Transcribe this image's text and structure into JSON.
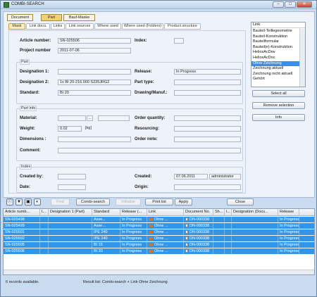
{
  "window": {
    "title": "COMBI-SEARCH",
    "min": "–",
    "max": "□",
    "close": "✕"
  },
  "top_tabs": [
    "Document",
    "Part",
    "Bauf-Maske"
  ],
  "sub_tabs": [
    "Mask",
    "Link docu.",
    "Links",
    "Link sources",
    "Where used",
    "Where used (Folders)",
    "Product structure"
  ],
  "header_fields": {
    "article_number_label": "Article number:",
    "article_number": "SN-025506",
    "index_label": "Index:",
    "project_number_label": "Project number",
    "project_number": "2011-07-06"
  },
  "part_group": {
    "title": "Part",
    "designation1_label": "Designation 1:",
    "designation1": "",
    "release_label": "Release:",
    "release": "In Progress",
    "designation2_label": "Designation 2:",
    "designation2": "1x BI 20-216.000 S235JRG2",
    "part_type_label": "Part type:",
    "part_type": "",
    "standard_label": "Standard:",
    "standard": "BI 20",
    "drawing_label": "Drawing/Manuf.:",
    "drawing": ""
  },
  "part_info_group": {
    "title": "Part info",
    "material_label": "Material:",
    "material_btn": "...",
    "order_quantity_label": "Order quantity:",
    "weight_label": "Weight:",
    "weight": "0.02",
    "weight_unit": "[kg]",
    "resourcing_label": "Resourcing:",
    "dimensions_label": "Dimensions :",
    "order_note_label": "Order note:",
    "comment_label": "Comment:"
  },
  "index_group": {
    "title": "Index",
    "created_by_label": "Created by:",
    "created_label": "Created:",
    "created_date": "07.06.2011",
    "created_user": "administrator",
    "date_label": "Date:",
    "origin_label": "Origin:"
  },
  "link_panel": {
    "header": "Link",
    "items": [
      "Bauteil-Teillegeometrie",
      "Bauteil-Konstruktion",
      "Bauteilformular",
      "Bauteil(e)-Konstruktion",
      "HeliosAcDrw",
      "HeliosAcDoc",
      "Ohne Zeichnung",
      "Zeichnung aktuell",
      "Zeichnung nicht aktuell",
      "Gehört"
    ],
    "selected_index": 6
  },
  "right_buttons": {
    "select_all": "Select all",
    "remove_selection": "Remove selection",
    "info": "Info"
  },
  "toolbar": {
    "icons": [
      "info-icon",
      "filter-icon",
      "folder-icon",
      "image-icon"
    ],
    "find": "Find",
    "combi_search": "Combi-search",
    "initialize": "Initialize",
    "print_list": "Print list",
    "apply": "Apply",
    "close": "Close"
  },
  "grid": {
    "columns": [
      "Article numb...",
      "I...",
      "Designation 1 (Part)",
      "Standard",
      "Release (...",
      "Link",
      "Document No.",
      "Sh...",
      "I...",
      "Designation (Docu...",
      "Release"
    ],
    "rows": [
      [
        "SN-025498",
        "",
        "",
        "Asse...",
        "In Progress",
        "Ohne ...",
        "DN-000338",
        "",
        "",
        "",
        "In Progress"
      ],
      [
        "SN-025499",
        "",
        "",
        "Asse...",
        "In Progress",
        "Ohne ...",
        "DN-000338",
        "",
        "",
        "",
        "In Progress"
      ],
      [
        "SN-025501",
        "",
        "",
        "IPE 240",
        "In Progress",
        "Ohne ...",
        "DN-000338",
        "",
        "",
        "",
        "In Progress"
      ],
      [
        "SN-025502",
        "",
        "",
        "IPE 240",
        "In Progress",
        "Ohne ...",
        "DN-000338",
        "",
        "",
        "",
        "In Progress"
      ],
      [
        "SN-025505",
        "",
        "",
        "BI 15",
        "In Progress",
        "Ohne ...",
        "DN-000338",
        "",
        "",
        "",
        "In Progress"
      ],
      [
        "SN-025506",
        "",
        "",
        "BI 20",
        "In Progress",
        "Ohne ...",
        "DN-000338",
        "",
        "",
        "",
        "In Progress"
      ]
    ]
  },
  "status": {
    "records": "6 records available.",
    "result": "Result list: Combi-search + Link Ohne Zeichnung"
  },
  "colors": {
    "selection": "#3296e8",
    "active_tab": "#f2d26f",
    "window_bg": "#c9dbee"
  }
}
